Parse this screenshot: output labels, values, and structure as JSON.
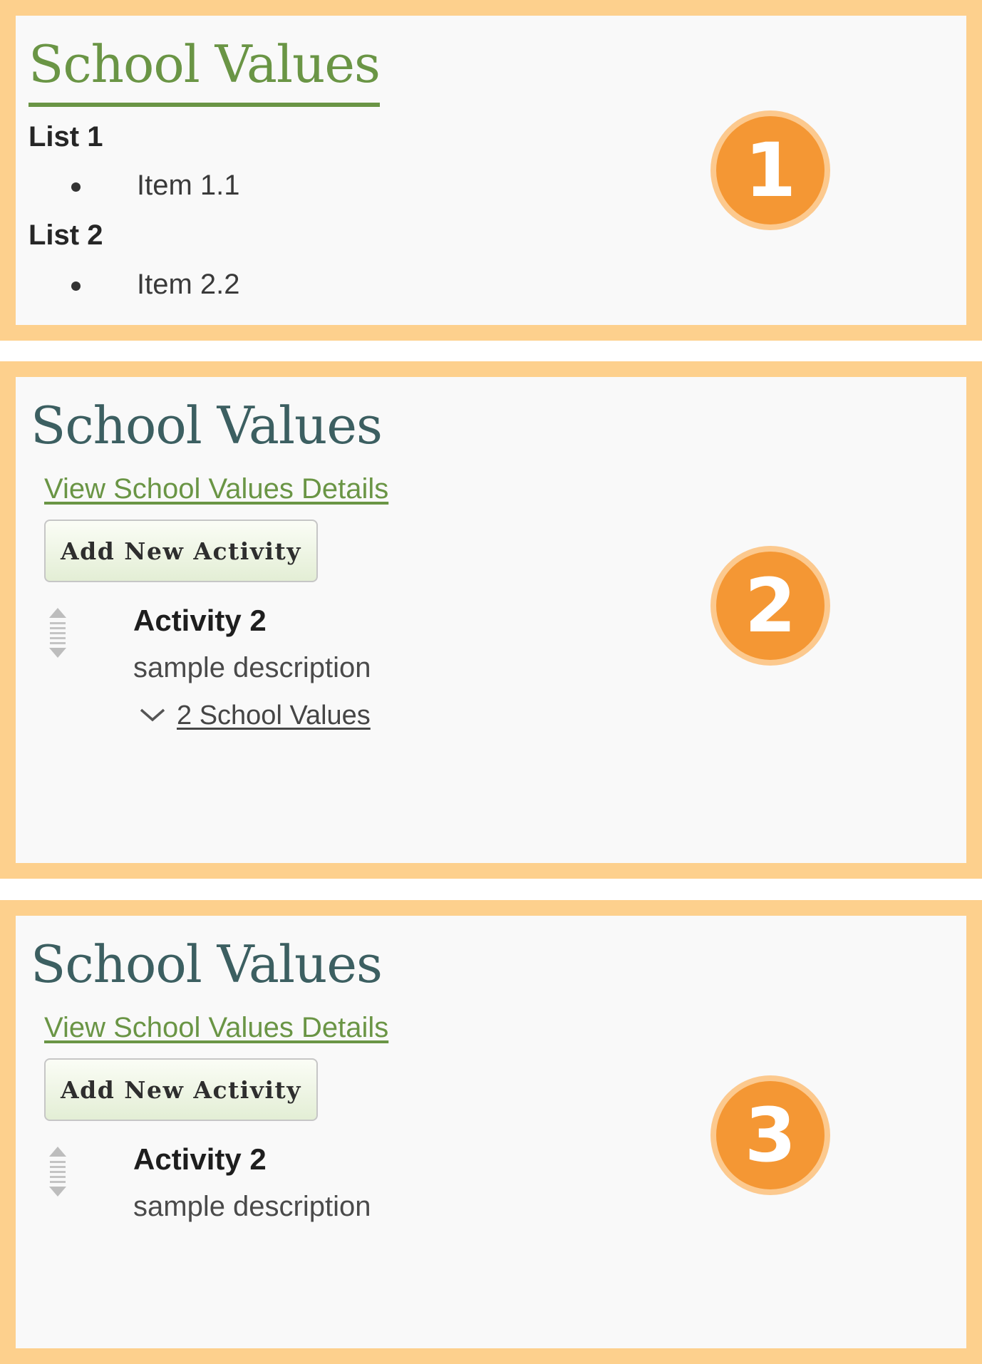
{
  "colors": {
    "frame": "#fdd08d",
    "panel_bg": "#f9f9f9",
    "title_link_green": "#6a9545",
    "title_teal": "#3c5f61",
    "badge_orange": "#f49734",
    "badge_ring": "#fcc98e"
  },
  "panel1": {
    "title": "School Values",
    "badge": "1",
    "lists": [
      {
        "heading": "List 1",
        "items": [
          "Item 1.1"
        ]
      },
      {
        "heading": "List 2",
        "items": [
          "Item 2.2"
        ]
      }
    ]
  },
  "panel2": {
    "title": "School Values",
    "details_link": "View School Values Details",
    "add_button": "Add New Activity",
    "activity": {
      "title": "Activity 2",
      "description": "sample description",
      "values_link": "2 School Values"
    },
    "badge": "2"
  },
  "panel3": {
    "title": "School Values",
    "details_link": "View School Values Details",
    "add_button": "Add New Activity",
    "activity": {
      "title": "Activity 2",
      "description": "sample description"
    },
    "badge": "3"
  },
  "icons": {
    "drag_handle": "drag-handle-icon",
    "chevron": "chevron-down-icon"
  }
}
